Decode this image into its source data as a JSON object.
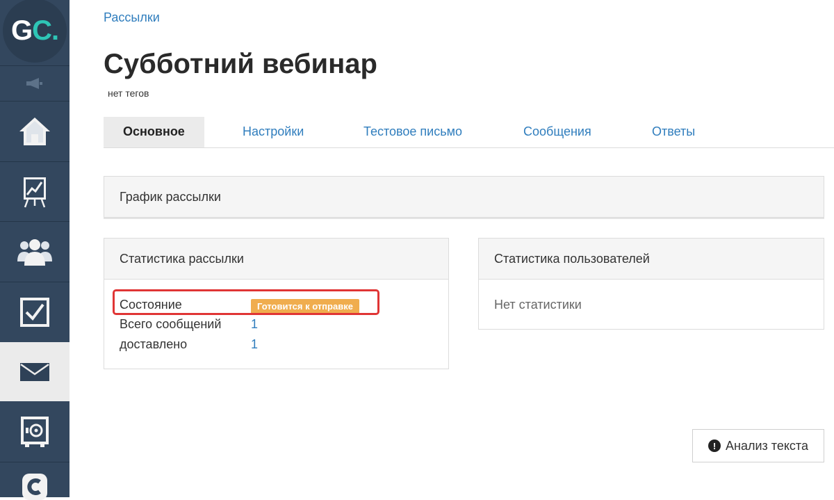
{
  "sidebar": {
    "logo": {
      "text_main": "G",
      "text_accent": "C."
    },
    "items": [
      {
        "name": "announcements-icon"
      },
      {
        "name": "home-icon"
      },
      {
        "name": "presentation-chart-icon"
      },
      {
        "name": "users-group-icon"
      },
      {
        "name": "checkbox-tasks-icon"
      },
      {
        "name": "envelope-icon",
        "active": true
      },
      {
        "name": "safe-icon"
      },
      {
        "name": "c-logo-icon"
      }
    ]
  },
  "breadcrumb": "Рассылки",
  "title": "Субботний вебинар",
  "tags": "нет тегов",
  "tabs": [
    {
      "label": "Основное",
      "active": true
    },
    {
      "label": "Настройки"
    },
    {
      "label": "Тестовое письмо"
    },
    {
      "label": "Сообщения"
    },
    {
      "label": "Ответы"
    }
  ],
  "schedule_panel": {
    "title": "График рассылки"
  },
  "stats_panel": {
    "title": "Статистика рассылки",
    "rows": [
      {
        "label": "Состояние",
        "badge": "Готовится к отправке"
      },
      {
        "label": "Всего сообщений",
        "value": "1"
      },
      {
        "label": "доставлено",
        "value": "1"
      }
    ]
  },
  "users_panel": {
    "title": "Статистика пользователей",
    "empty_text": "Нет статистики"
  },
  "analysis_button": {
    "label": "Анализ текста",
    "icon": "exclamation-circle-icon"
  },
  "colors": {
    "sidebar": "#33475e",
    "accent_teal": "#2ec5b6",
    "link": "#2f7dbd",
    "badge": "#f0ad4e",
    "highlight": "#e03535"
  }
}
